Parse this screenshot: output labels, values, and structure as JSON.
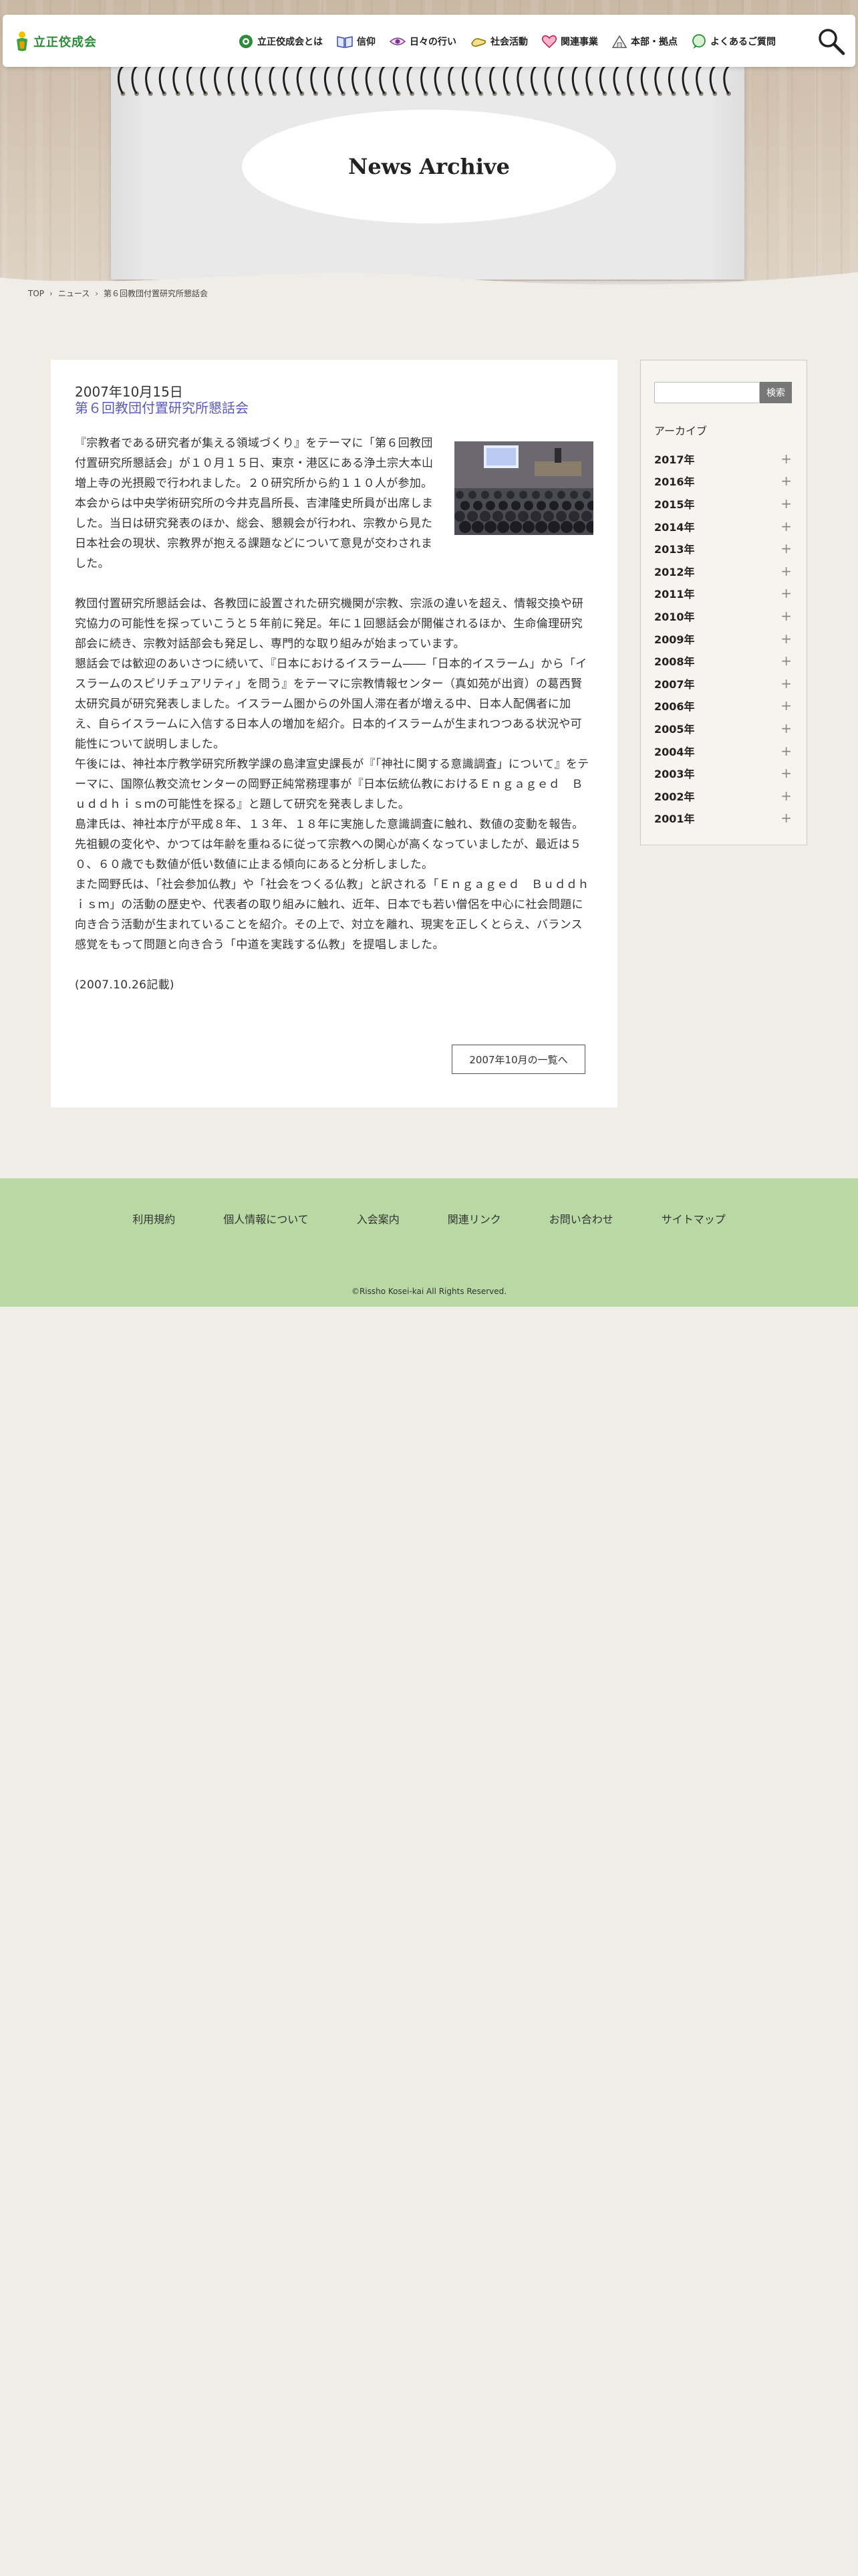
{
  "header": {
    "logo_text": "立正佼成会",
    "nav": [
      {
        "label": "立正佼成会とは",
        "icon": "circle-logo-icon"
      },
      {
        "label": "信仰",
        "icon": "book-icon"
      },
      {
        "label": "日々の行い",
        "icon": "eye-icon"
      },
      {
        "label": "社会活動",
        "icon": "hands-icon"
      },
      {
        "label": "関連事業",
        "icon": "heart-icon"
      },
      {
        "label": "本部・拠点",
        "icon": "building-icon"
      },
      {
        "label": "よくあるご質問",
        "icon": "speech-bubble-icon"
      }
    ],
    "search_icon": "magnifier-icon"
  },
  "hero": {
    "title": "News Archive"
  },
  "breadcrumb": {
    "home": "TOP",
    "section": "ニュース",
    "current": "第６回教団付置研究所懇話会"
  },
  "article": {
    "date": "2007年10月15日",
    "title": "第６回教団付置研究所懇話会",
    "paragraph1": "『宗教者である研究者が集える領域づくり』をテーマに「第６回教団付置研究所懇話会」が１０月１５日、東京・港区にある浄土宗大本山増上寺の光摂殿で行われました。２０研究所から約１１０人が参加。本会からは中央学術研究所の今井克昌所長、吉津隆史所員が出席しました。当日は研究発表のほか、総会、懇親会が行われ、宗教から見た日本社会の現状、宗教界が抱える課題などについて意見が交わされました。",
    "paragraph2": [
      "教団付置研究所懇話会は、各教団に設置された研究機関が宗教、宗派の違いを超え、情報交換や研究協力の可能性を探っていこうと５年前に発足。年に１回懇話会が開催されるほか、生命倫理研究部会に続き、宗教対話部会も発足し、専門的な取り組みが始まっています。",
      "懇話会では歓迎のあいさつに続いて、『日本におけるイスラーム――「日本的イスラーム」から「イスラームのスピリチュアリティ」を問う』をテーマに宗教情報センター（真如苑が出資）の葛西賢太研究員が研究発表しました。イスラーム圏からの外国人滞在者が増える中、日本人配偶者に加え、自らイスラームに入信する日本人の増加を紹介。日本的イスラームが生まれつつある状況や可能性について説明しました。",
      "午後には、神社本庁教学研究所教学課の島津宣史課長が『「神社に関する意識調査」について』をテーマに、国際仏教交流センターの岡野正純常務理事が『日本伝統仏教におけるＥｎｇａｇｅｄ　Ｂｕｄｄｈｉｓｍの可能性を探る』と題して研究を発表しました。",
      "島津氏は、神社本庁が平成８年、１３年、１８年に実施した意識調査に触れ、数値の変動を報告。先祖観の変化や、かつては年齢を重ねるに従って宗教への関心が高くなっていましたが、最近は５０、６０歳でも数値が低い数値に止まる傾向にあると分析しました。",
      "また岡野氏は、「社会参加仏教」や「社会をつくる仏教」と訳される「Ｅｎｇａｇｅｄ　Ｂｕｄｄｈｉｓｍ」の活動の歴史や、代表者の取り組みに触れ、近年、日本でも若い僧侶を中心に社会問題に向き合う活動が生まれていることを紹介。その上で、対立を離れ、現実を正しくとらえ、バランス感覚をもって問題と向き合う「中道を実践する仏教」を提唱しました。"
    ],
    "note": "(2007.10.26記載)",
    "more_button": "2007年10月の一覧へ"
  },
  "sidebar": {
    "search_button": "検索",
    "archive_heading": "アーカイブ",
    "years": [
      "2017年",
      "2016年",
      "2015年",
      "2014年",
      "2013年",
      "2012年",
      "2011年",
      "2010年",
      "2009年",
      "2008年",
      "2007年",
      "2006年",
      "2005年",
      "2004年",
      "2003年",
      "2002年",
      "2001年"
    ],
    "expand_symbol": "+"
  },
  "footer": {
    "links": [
      "利用規約",
      "個人情報について",
      "入会案内",
      "関連リンク",
      "お問い合わせ",
      "サイトマップ"
    ],
    "copyright": "©Rissho Kosei-kai All Rights Reserved."
  },
  "colors": {
    "accent_green": "#2e8b3a",
    "title_purple": "#5a5ab8",
    "footer_green": "#b8d9a3",
    "search_button_gray": "#777777"
  }
}
